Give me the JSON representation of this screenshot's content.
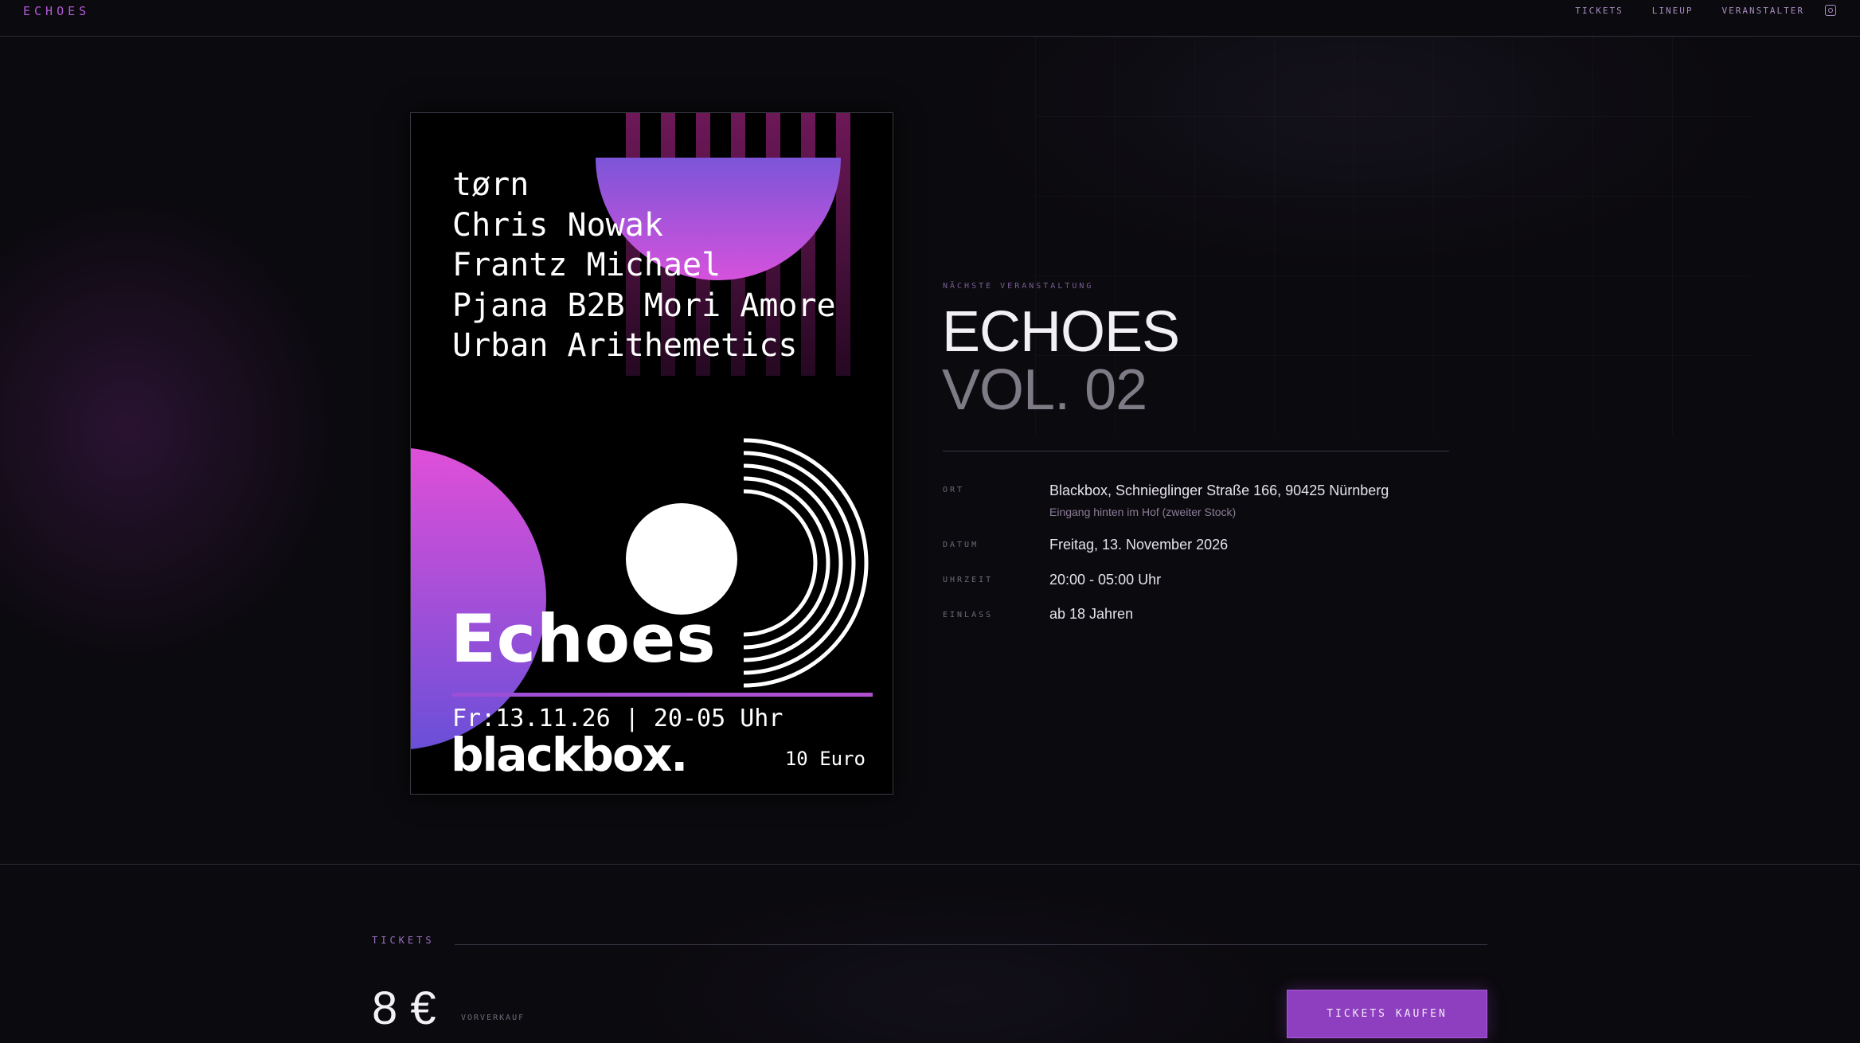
{
  "header": {
    "brand": "ECHOES",
    "nav": [
      "TICKETS",
      "LINEUP",
      "VERANSTALTER"
    ],
    "social_icon": "instagram-icon"
  },
  "poster": {
    "lineup": [
      "tørn",
      "Chris Nowak",
      "Frantz Michael",
      "Pjana B2B Mori Amore",
      "Urban Arithemetics"
    ],
    "title": "Echoes",
    "date_line": "Fr:13.11.26 | 20-05 Uhr",
    "venue": "blackbox.",
    "price": "10 Euro"
  },
  "event": {
    "kicker": "NÄCHSTE VERANSTALTUNG",
    "title": "ECHOES",
    "subtitle": "VOL. 02",
    "details": {
      "location_label": "ORT",
      "location": "Blackbox, Schnieglinger Straße 166, 90425 Nürnberg",
      "location_note": "Eingang hinten im Hof (zweiter Stock)",
      "date_label": "DATUM",
      "date": "Freitag, 13. November 2026",
      "time_label": "UHRZEIT",
      "time": "20:00 - 05:00 Uhr",
      "entry_label": "EINLASS",
      "entry": "ab 18 Jahren"
    }
  },
  "tickets": {
    "section_label": "TICKETS",
    "price": "8 €",
    "price_note": "VORVERKAUF",
    "buy_label": "TICKETS KAUFEN"
  },
  "colors": {
    "accent": "#8e3fbf",
    "brand": "#b45ad8",
    "background": "#0b0a0e"
  }
}
